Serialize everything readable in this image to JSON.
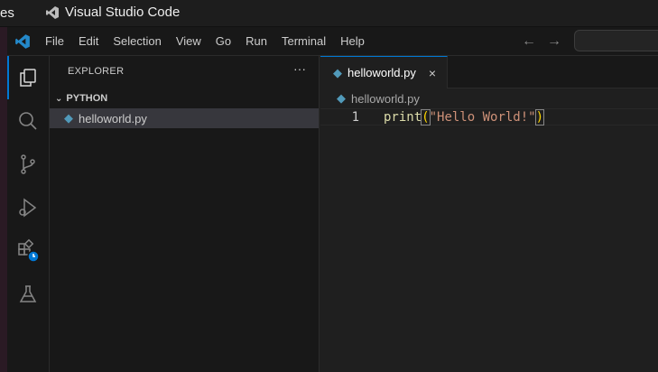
{
  "os": {
    "left_text": "es",
    "window_title": "Visual Studio Code"
  },
  "menu": [
    "File",
    "Edit",
    "Selection",
    "View",
    "Go",
    "Run",
    "Terminal",
    "Help"
  ],
  "activity": [
    "explorer-icon",
    "search-icon",
    "source-control-icon",
    "run-debug-icon",
    "extensions-icon",
    "testing-icon"
  ],
  "sidebar": {
    "title": "EXPLORER",
    "more": "···",
    "folder": "PYTHON",
    "file": "helloworld.py"
  },
  "editor": {
    "tab": "helloworld.py",
    "close": "×",
    "breadcrumb": "helloworld.py",
    "line_number": "1",
    "code": {
      "fn": "print",
      "open": "(",
      "str": "\"Hello World!\"",
      "close": ")"
    }
  },
  "colors": {
    "accent": "#0078d4",
    "python_icon": "#519aba"
  }
}
